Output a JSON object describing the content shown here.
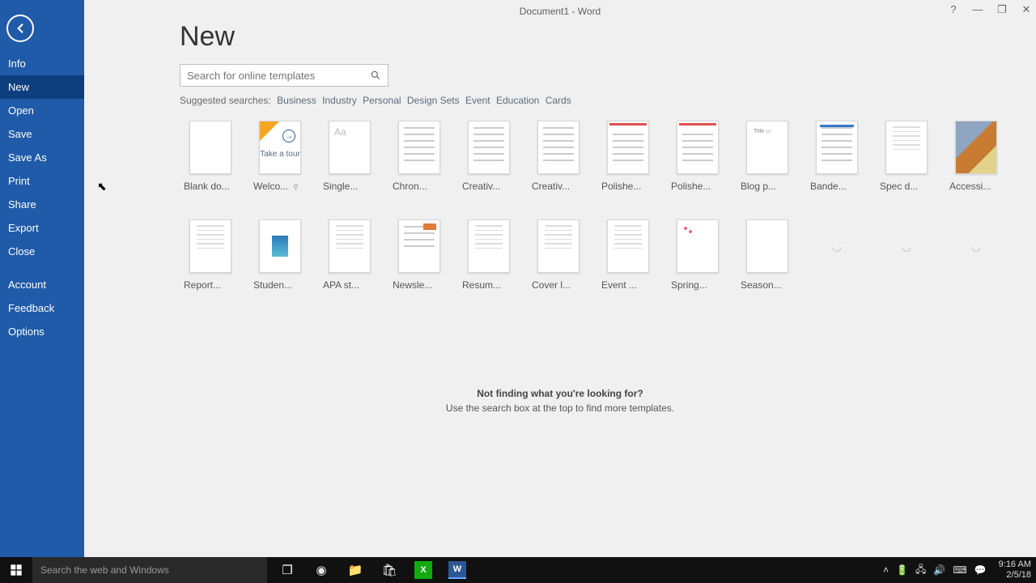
{
  "titlebar": {
    "title": "Document1  -  Word"
  },
  "win": {
    "help": "?",
    "min": "—",
    "max": "❐",
    "close": "✕"
  },
  "sidebar": {
    "items": [
      {
        "label": "Info"
      },
      {
        "label": "New",
        "selected": true
      },
      {
        "label": "Open"
      },
      {
        "label": "Save"
      },
      {
        "label": "Save As"
      },
      {
        "label": "Print"
      },
      {
        "label": "Share"
      },
      {
        "label": "Export"
      },
      {
        "label": "Close"
      }
    ],
    "items2": [
      {
        "label": "Account"
      },
      {
        "label": "Feedback"
      },
      {
        "label": "Options"
      }
    ]
  },
  "page": {
    "title": "New",
    "search_placeholder": "Search for online templates",
    "suggested_label": "Suggested searches:",
    "suggested": [
      "Business",
      "Industry",
      "Personal",
      "Design Sets",
      "Event",
      "Education",
      "Cards"
    ]
  },
  "templates": [
    {
      "label": "Blank do...",
      "kind": "blank"
    },
    {
      "label": "Welco...",
      "kind": "tour",
      "text": "Take a tour",
      "pin": "📌"
    },
    {
      "label": "Single...",
      "kind": "single",
      "text": "Aa"
    },
    {
      "label": "Chron...",
      "kind": "lines"
    },
    {
      "label": "Creativ...",
      "kind": "lines"
    },
    {
      "label": "Creativ...",
      "kind": "lines"
    },
    {
      "label": "Polishe...",
      "kind": "redtop"
    },
    {
      "label": "Polishe...",
      "kind": "redtop"
    },
    {
      "label": "Blog p...",
      "kind": "title",
      "text": "Title"
    },
    {
      "label": "Bande...",
      "kind": "bluetop"
    },
    {
      "label": "Spec d...",
      "kind": "lorem"
    },
    {
      "label": "Accessi...",
      "kind": "img"
    },
    {
      "label": "Report...",
      "kind": "lorem"
    },
    {
      "label": "Studen...",
      "kind": "blue"
    },
    {
      "label": "APA st...",
      "kind": "lorem"
    },
    {
      "label": "Newsle...",
      "kind": "news"
    },
    {
      "label": "Resum...",
      "kind": "lorem"
    },
    {
      "label": "Cover l...",
      "kind": "lorem"
    },
    {
      "label": "Event ...",
      "kind": "lorem"
    },
    {
      "label": "Spring...",
      "kind": "pink"
    },
    {
      "label": "Season...",
      "kind": "green"
    },
    {
      "label": "",
      "kind": "loading"
    },
    {
      "label": "",
      "kind": "loading"
    },
    {
      "label": "",
      "kind": "loading"
    }
  ],
  "footer": {
    "line1": "Not finding what you're looking for?",
    "line2": "Use the search box at the top to find more templates."
  },
  "taskbar": {
    "search_placeholder": "Search the web and Windows",
    "time": "9:16 AM",
    "date": "2/5/18"
  }
}
